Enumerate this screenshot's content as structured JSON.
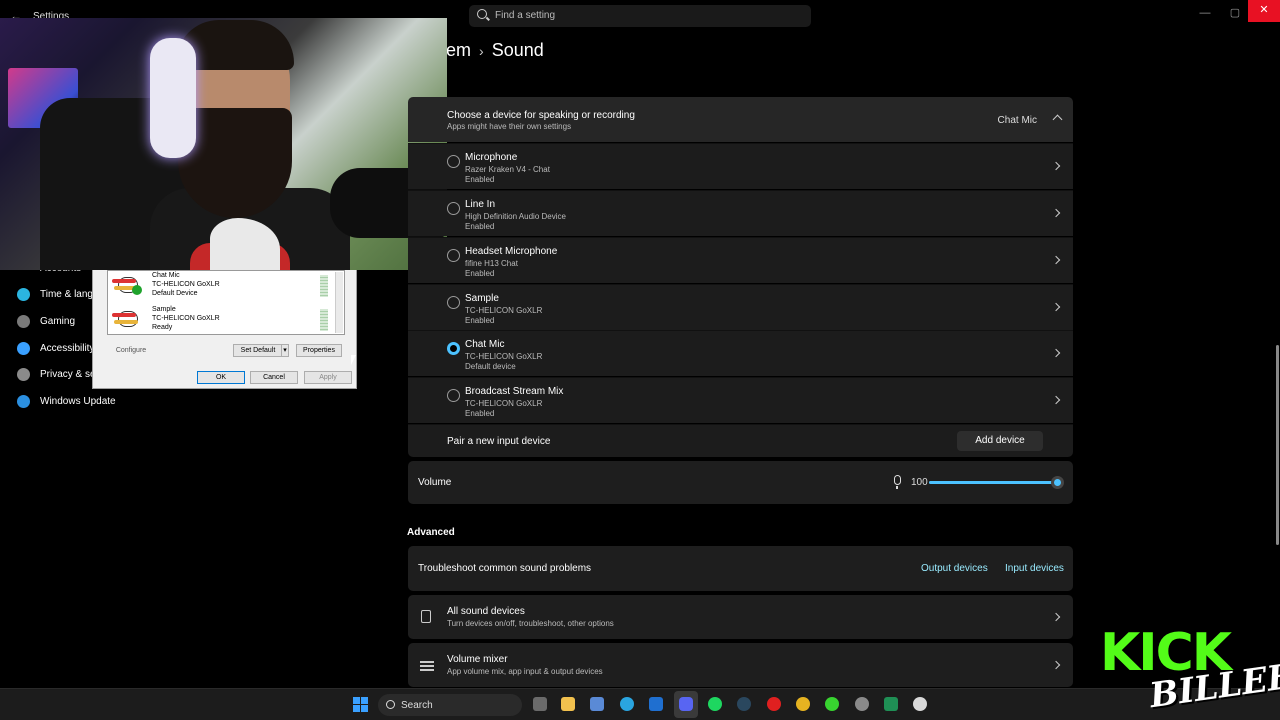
{
  "window": {
    "title": "Settings",
    "search_placeholder": "Find a setting",
    "close_glyph": "✕"
  },
  "breadcrumb": {
    "parent": "em",
    "current": "Sound"
  },
  "nav": {
    "partial_top": "Accounts",
    "items": [
      {
        "label": "Time & langu",
        "icon": "clock-globe-icon",
        "color": "#2bb5e0"
      },
      {
        "label": "Gaming",
        "icon": "gamepad-icon",
        "color": "#7a7a7a"
      },
      {
        "label": "Accessibility",
        "icon": "accessibility-icon",
        "color": "#3aa0ff"
      },
      {
        "label": "Privacy & se",
        "icon": "shield-icon",
        "color": "#8a8a8a"
      },
      {
        "label": "Windows Update",
        "icon": "update-icon",
        "color": "#2b8fe0"
      }
    ]
  },
  "dialog": {
    "devices": [
      {
        "name": "Chat Mic",
        "device": "TC-HELICON GoXLR",
        "status": "Default Device",
        "is_default": true
      },
      {
        "name": "Sample",
        "device": "TC-HELICON GoXLR",
        "status": "Ready",
        "is_default": false
      }
    ],
    "configure": "Configure",
    "set_default": "Set Default",
    "properties": "Properties",
    "ok": "OK",
    "cancel": "Cancel",
    "apply": "Apply"
  },
  "input": {
    "header_title": "Choose a device for speaking or recording",
    "header_subtitle": "Apps might have their own settings",
    "selected": "Chat Mic",
    "devices": [
      {
        "name": "Microphone",
        "device": "Razer Kraken V4 - Chat",
        "status": "Enabled",
        "selected": false
      },
      {
        "name": "Line In",
        "device": "High Definition Audio Device",
        "status": "Enabled",
        "selected": false
      },
      {
        "name": "Headset Microphone",
        "device": "fifine H13 Chat",
        "status": "Enabled",
        "selected": false
      },
      {
        "name": "Sample",
        "device": "TC-HELICON GoXLR",
        "status": "Enabled",
        "selected": false
      },
      {
        "name": "Chat Mic",
        "device": "TC-HELICON GoXLR",
        "status": "Default device",
        "selected": true
      },
      {
        "name": "Broadcast Stream Mix",
        "device": "TC-HELICON GoXLR",
        "status": "Enabled",
        "selected": false
      }
    ],
    "pair_label": "Pair a new input device",
    "add_device": "Add device"
  },
  "volume": {
    "label": "Volume",
    "value": "100",
    "level": 1.0
  },
  "advanced": {
    "title": "Advanced",
    "troubleshoot": "Troubleshoot common sound problems",
    "output_link": "Output devices",
    "input_link": "Input devices",
    "all_devices_title": "All sound devices",
    "all_devices_sub": "Turn devices on/off, troubleshoot, other options",
    "mixer_title": "Volume mixer",
    "mixer_sub": "App volume mix, app input & output devices"
  },
  "taskbar": {
    "search": "Search"
  },
  "overlay": {
    "kick": "KICK",
    "name": "BILLEH"
  },
  "colors": {
    "accent": "#4cc2ff",
    "close": "#e81123",
    "kick_green": "#53fc18"
  }
}
